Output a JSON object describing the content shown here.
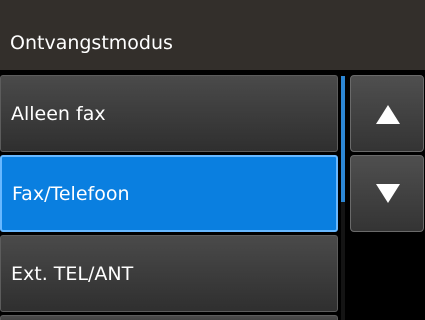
{
  "header": {
    "title": "Ontvangstmodus"
  },
  "options": [
    {
      "label": "Alleen fax",
      "selected": false
    },
    {
      "label": "Fax/Telefoon",
      "selected": true
    },
    {
      "label": "Ext. TEL/ANT",
      "selected": false
    },
    {
      "label": "",
      "selected": false
    }
  ],
  "controls": {
    "up_icon": "triangle-up-icon",
    "down_icon": "triangle-down-icon"
  },
  "colors": {
    "header_bg": "#332f2b",
    "selected_bg": "#0a7fe0",
    "accent": "#2c86d4"
  }
}
